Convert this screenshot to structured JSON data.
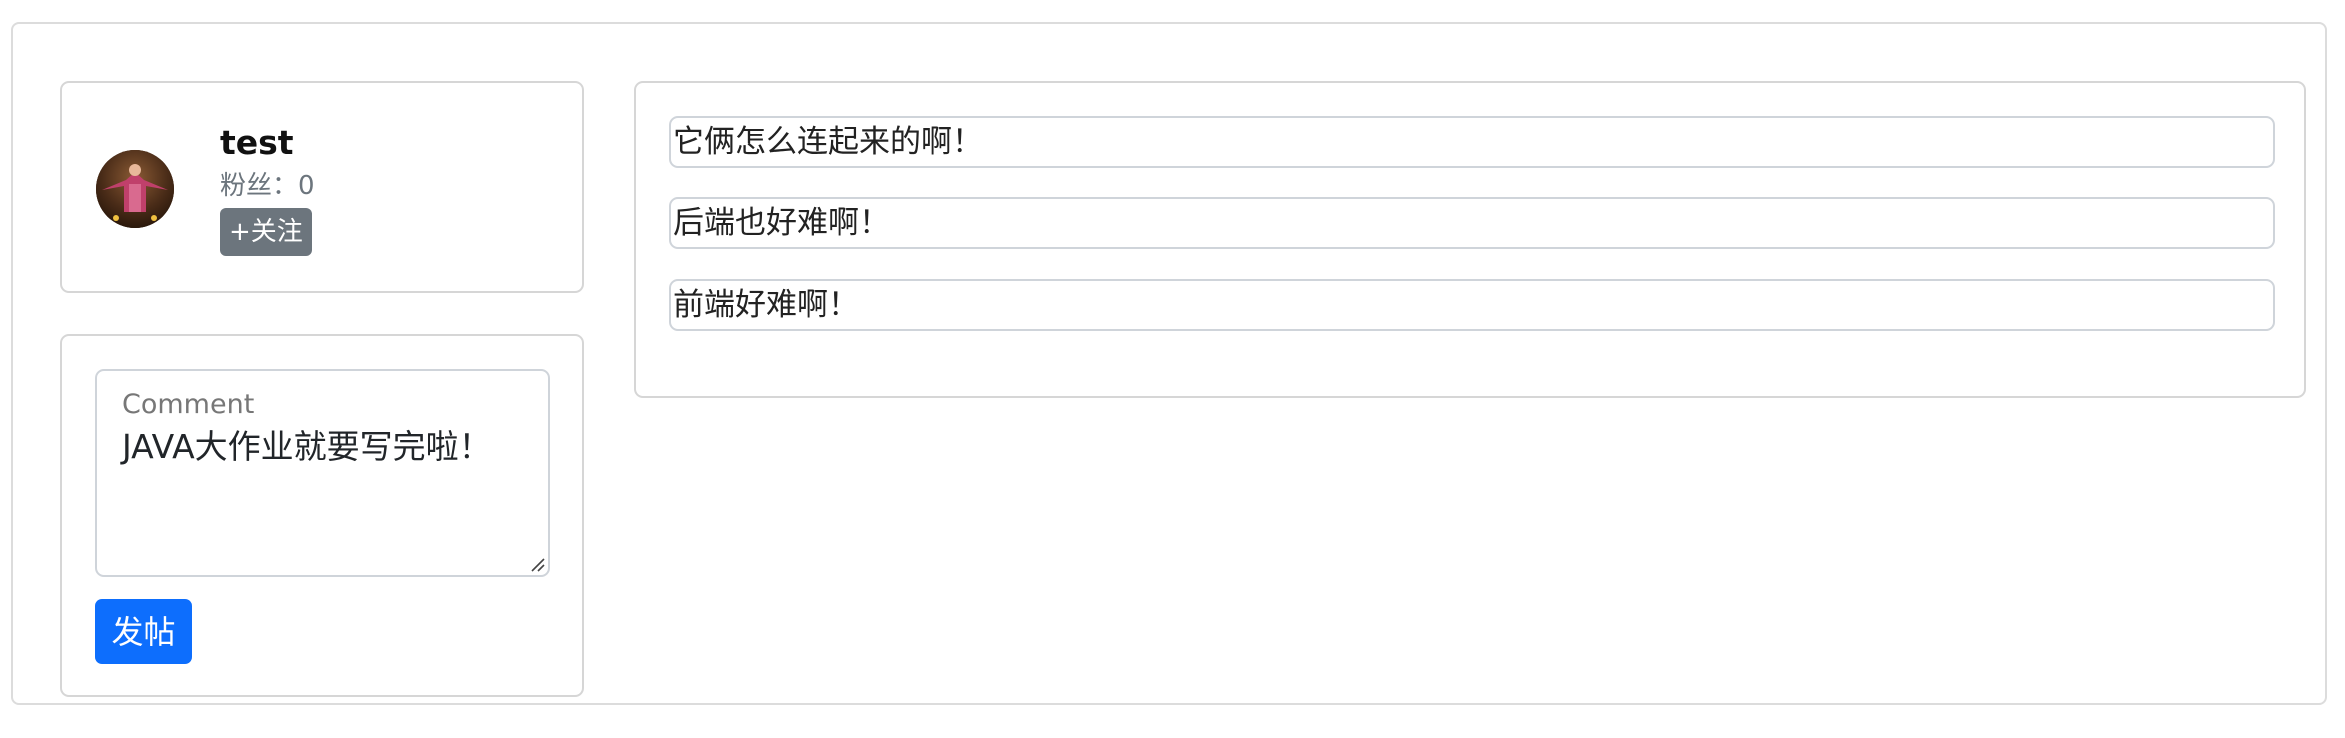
{
  "profile": {
    "username": "test",
    "fans_label": "粉丝：",
    "fans_count": "0",
    "follow_label": "+关注",
    "avatar_icon": "user-avatar-photo"
  },
  "composer": {
    "floating_label": "Comment",
    "value": "JAVA大作业就要写完啦！",
    "submit_label": "发帖"
  },
  "feed": {
    "posts": [
      {
        "text": "它俩怎么连起来的啊！"
      },
      {
        "text": "后端也好难啊！"
      },
      {
        "text": "前端好难啊！"
      }
    ]
  },
  "colors": {
    "primary": "#0d6efd",
    "secondary": "#6c757d",
    "border": "#d6d6d6"
  }
}
